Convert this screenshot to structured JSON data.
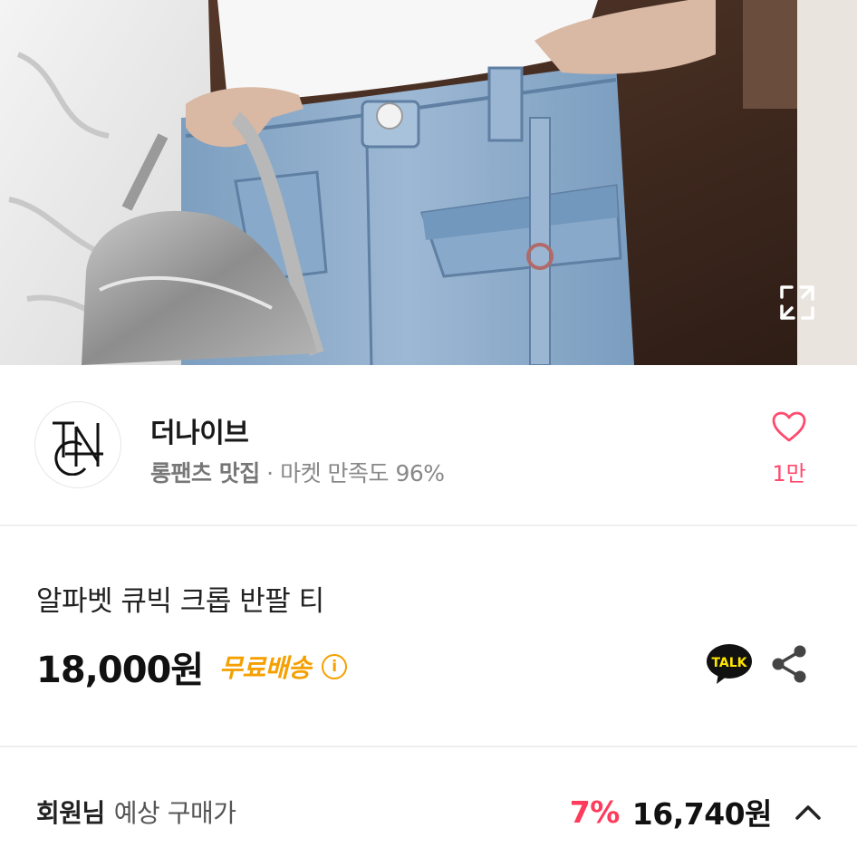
{
  "hero": {
    "expand_icon": "expand-arrows-icon"
  },
  "seller": {
    "logo": "TN monogram logo",
    "name": "더나이브",
    "tag": "롱팬츠 맛집",
    "separator": " · ",
    "satisfaction": "마켓 만족도 96%",
    "like_icon": "heart-outline-icon",
    "like_count": "1만"
  },
  "product": {
    "title": "알파벳 큐빅 크롭 반팔 티",
    "price": "18,000원",
    "free_shipping": "무료배송",
    "info_icon": "info-circle-icon",
    "talk_label": "TALK",
    "share_icon": "share-icon"
  },
  "member_price": {
    "label": "회원님",
    "sub": "예상 구매가",
    "discount": "7%",
    "price": "16,740원",
    "toggle_icon": "chevron-up-icon"
  },
  "colors": {
    "accent_pink": "#ff3b5c",
    "free_shipping_orange": "#f5a000",
    "talk_yellow": "#fee500"
  }
}
